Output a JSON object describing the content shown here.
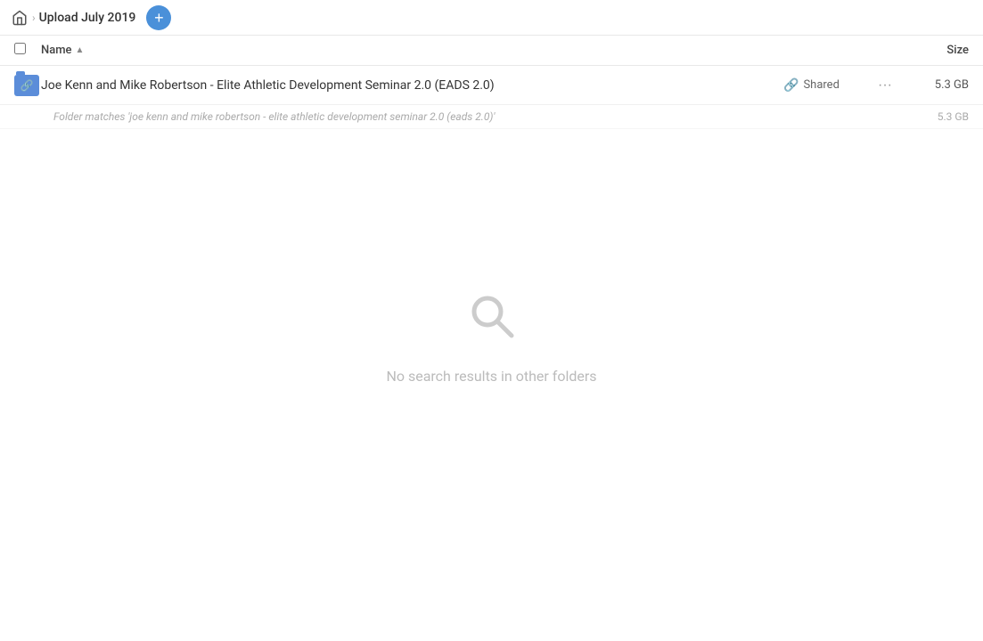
{
  "header": {
    "home_icon_label": "home",
    "breadcrumb_separator": "›",
    "breadcrumb_title": "Upload July 2019",
    "add_button_label": "+"
  },
  "columns": {
    "name_label": "Name",
    "sort_arrow": "▲",
    "size_label": "Size"
  },
  "file_row": {
    "name": "Joe Kenn and Mike Robertson - Elite Athletic Development Seminar 2.0 (EADS 2.0)",
    "shared_label": "Shared",
    "size": "5.3 GB",
    "more_label": "···"
  },
  "sub_match": {
    "text": "Folder matches 'joe kenn and mike robertson - elite athletic development seminar 2.0 (eads 2.0)'",
    "size": "5.3 GB"
  },
  "empty_state": {
    "message": "No search results in other folders"
  }
}
